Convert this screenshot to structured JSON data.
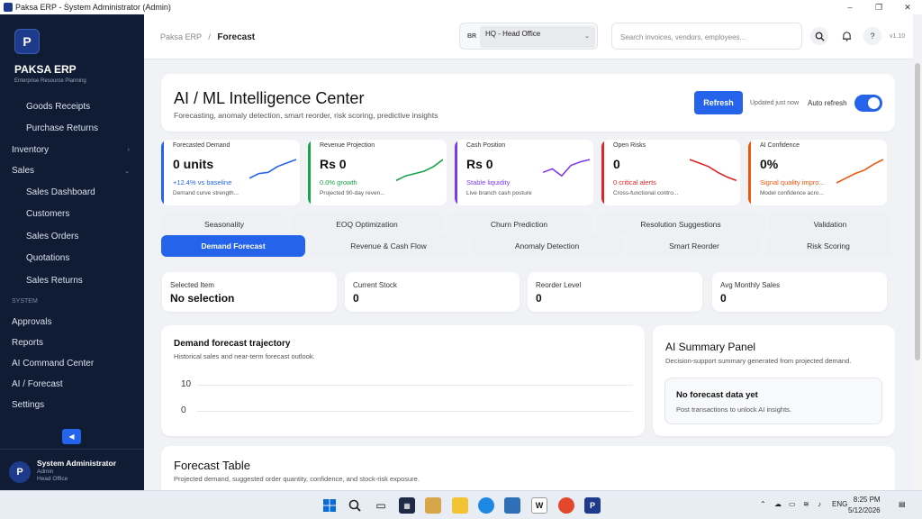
{
  "window": {
    "title": "Paksa ERP - System Administrator (Admin)",
    "min": "–",
    "max": "❐",
    "close": "✕"
  },
  "sidebar": {
    "logo": "P",
    "brand": "PAKSA ERP",
    "brand_sub": "Enterprise Resource Planning",
    "items": [
      {
        "label": "Goods Receipts",
        "kind": "sub"
      },
      {
        "label": "Purchase Returns",
        "kind": "sub"
      },
      {
        "label": "Inventory",
        "kind": "top",
        "chev": "›"
      },
      {
        "label": "Sales",
        "kind": "top",
        "chev": "⌄"
      },
      {
        "label": "Sales Dashboard",
        "kind": "sub"
      },
      {
        "label": "Customers",
        "kind": "sub"
      },
      {
        "label": "Sales Orders",
        "kind": "sub"
      },
      {
        "label": "Quotations",
        "kind": "sub"
      },
      {
        "label": "Sales Returns",
        "kind": "sub"
      },
      {
        "label": "SYSTEM",
        "kind": "section"
      },
      {
        "label": "Approvals",
        "kind": "top"
      },
      {
        "label": "Reports",
        "kind": "top"
      },
      {
        "label": "AI Command Center",
        "kind": "top"
      },
      {
        "label": "AI / Forecast",
        "kind": "top"
      },
      {
        "label": "Settings",
        "kind": "top"
      }
    ],
    "collapse": "◀",
    "user": {
      "avatar": "P",
      "name": "System Administrator",
      "role": "Admin",
      "office": "Head Office"
    }
  },
  "topbar": {
    "crumb_root": "Paksa ERP",
    "crumb_sep": "/",
    "crumb_current": "Forecast",
    "branch_code": "BR",
    "branch_value": "HQ - Head Office",
    "search_placeholder": "Search invoices, vendors, employees...",
    "version": "v1.10"
  },
  "hero": {
    "title": "AI / ML Intelligence Center",
    "subtitle": "Forecasting, anomaly detection, smart reorder, risk scoring, predictive insights",
    "refresh": "Refresh",
    "updated": "Updated just now",
    "auto_refresh": "Auto refresh"
  },
  "kpis": [
    {
      "label": "Forecasted Demand",
      "value": "0 units",
      "change": "+12.4% vs baseline",
      "note": "Demand curve strength...",
      "color": "#2563eb",
      "spark": [
        0.2,
        0.4,
        0.45,
        0.7,
        0.85,
        1.0
      ]
    },
    {
      "label": "Revenue Projection",
      "value": "Rs 0",
      "change": "0.0% growth",
      "note": "Projected 90-day reven...",
      "color": "#16a34a",
      "spark": [
        0.1,
        0.3,
        0.4,
        0.5,
        0.7,
        1.0
      ]
    },
    {
      "label": "Cash Position",
      "value": "Rs 0",
      "change": "Stable liquidity",
      "note": "Live branch cash posture",
      "color": "#7c3aed",
      "spark": [
        0.45,
        0.6,
        0.3,
        0.75,
        0.9,
        1.0
      ]
    },
    {
      "label": "Open Risks",
      "value": "0",
      "change": "0 critical alerts",
      "note": "Cross-functional contro...",
      "color": "#dc2626",
      "spark": [
        1.0,
        0.85,
        0.7,
        0.45,
        0.25,
        0.1
      ]
    },
    {
      "label": "AI Confidence",
      "value": "0%",
      "change": "Signal quality impro...",
      "note": "Model confidence acro...",
      "color": "#ea580c",
      "spark": [
        0.0,
        0.2,
        0.4,
        0.55,
        0.8,
        1.0
      ]
    }
  ],
  "tabs_row1": [
    "Seasonality",
    "EOQ Optimization",
    "Churn Prediction",
    "Resolution Suggestions",
    "Validation"
  ],
  "tabs_row2": [
    "Demand Forecast",
    "Revenue & Cash Flow",
    "Anomaly Detection",
    "Smart Reorder",
    "Risk Scoring"
  ],
  "stats": [
    {
      "label": "Selected Item",
      "value": "No selection"
    },
    {
      "label": "Current Stock",
      "value": "0"
    },
    {
      "label": "Reorder Level",
      "value": "0"
    },
    {
      "label": "Avg Monthly Sales",
      "value": "0"
    }
  ],
  "chart_panel": {
    "title": "Demand forecast trajectory",
    "subtitle": "Historical sales and near-term forecast outlook."
  },
  "chart_data": {
    "type": "line",
    "title": "",
    "xlabel": "",
    "ylabel": "",
    "yticks": [
      "10",
      "0"
    ],
    "ylim": [
      0,
      10
    ],
    "series": []
  },
  "ai_panel": {
    "title": "AI Summary Panel",
    "subtitle": "Decision-support summary generated from projected demand.",
    "empty_title": "No forecast data yet",
    "empty_sub": "Post transactions to unlock AI insights."
  },
  "forecast_table": {
    "title": "Forecast Table",
    "subtitle": "Projected demand, suggested order quantity, confidence, and stock-risk exposure."
  },
  "taskbar": {
    "lang": "ENG",
    "time": "8:25 PM",
    "date": "5/12/2026"
  }
}
